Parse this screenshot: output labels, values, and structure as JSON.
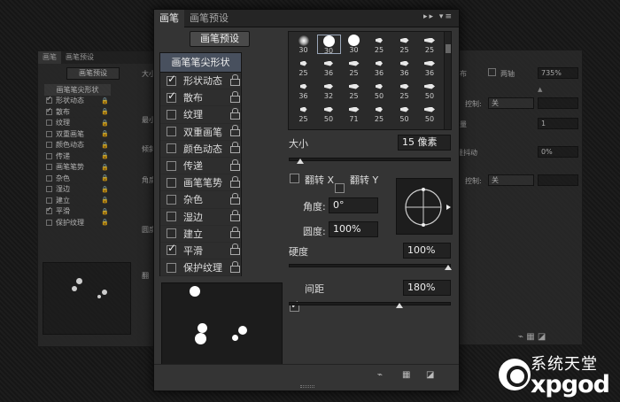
{
  "ghost_left": {
    "tabs": [
      "画笔",
      "画笔预设"
    ],
    "preset_button": "画笔预设",
    "list_header": "画笔笔尖形状",
    "rows": [
      {
        "label": "形状动态",
        "checked": true
      },
      {
        "label": "散布",
        "checked": true
      },
      {
        "label": "纹理",
        "checked": false
      },
      {
        "label": "双重画笔",
        "checked": false
      },
      {
        "label": "颜色动态",
        "checked": false
      },
      {
        "label": "传递",
        "checked": false
      },
      {
        "label": "画笔笔势",
        "checked": false
      },
      {
        "label": "杂色",
        "checked": false
      },
      {
        "label": "湿边",
        "checked": false
      },
      {
        "label": "建立",
        "checked": false
      },
      {
        "label": "平滑",
        "checked": true
      },
      {
        "label": "保护纹理",
        "checked": false
      }
    ],
    "side_labels": [
      "大小",
      "最小",
      "倾斜",
      "角度",
      "圆度",
      "翻"
    ]
  },
  "ghost_right": {
    "two_axis_label": "两轴",
    "percent_value": "735%",
    "control_label": "控制:",
    "control_value": "关",
    "count_value": "1",
    "jitter_label": "量抖动",
    "jitter_value": "0%",
    "control2_label": "控制:",
    "control2_value": "关",
    "fragments": [
      "布",
      "量"
    ]
  },
  "main": {
    "tabs": [
      "画笔",
      "画笔预设"
    ],
    "preset_button": "画笔预设",
    "list_header": "画笔笔尖形状",
    "rows": [
      {
        "label": "形状动态",
        "checked": true
      },
      {
        "label": "散布",
        "checked": true
      },
      {
        "label": "纹理",
        "checked": false
      },
      {
        "label": "双重画笔",
        "checked": false
      },
      {
        "label": "颜色动态",
        "checked": false
      },
      {
        "label": "传递",
        "checked": false
      },
      {
        "label": "画笔笔势",
        "checked": false
      },
      {
        "label": "杂色",
        "checked": false
      },
      {
        "label": "湿边",
        "checked": false
      },
      {
        "label": "建立",
        "checked": false
      },
      {
        "label": "平滑",
        "checked": true
      },
      {
        "label": "保护纹理",
        "checked": false
      }
    ],
    "brush_tips": [
      [
        "30",
        "30",
        "30",
        "25",
        "25",
        "25"
      ],
      [
        "25",
        "36",
        "25",
        "36",
        "36",
        "36"
      ],
      [
        "36",
        "32",
        "25",
        "50",
        "25",
        "50"
      ],
      [
        "25",
        "50",
        "71",
        "25",
        "50",
        "50"
      ]
    ],
    "size_label": "大小",
    "size_value": "15 像素",
    "flip_x_label": "翻转 X",
    "flip_y_label": "翻转 Y",
    "angle_label": "角度:",
    "angle_value": "0°",
    "roundness_label": "圆度:",
    "roundness_value": "100%",
    "hardness_label": "硬度",
    "hardness_value": "100%",
    "spacing_label": "间距",
    "spacing_value": "180%",
    "spacing_checked": true
  },
  "watermark": {
    "text_cn": "系统天堂",
    "text_en": "xpgod"
  },
  "colors": {
    "panel_bg": "#343434",
    "list_header_bg": "#48505e",
    "field_bg": "#222222"
  }
}
